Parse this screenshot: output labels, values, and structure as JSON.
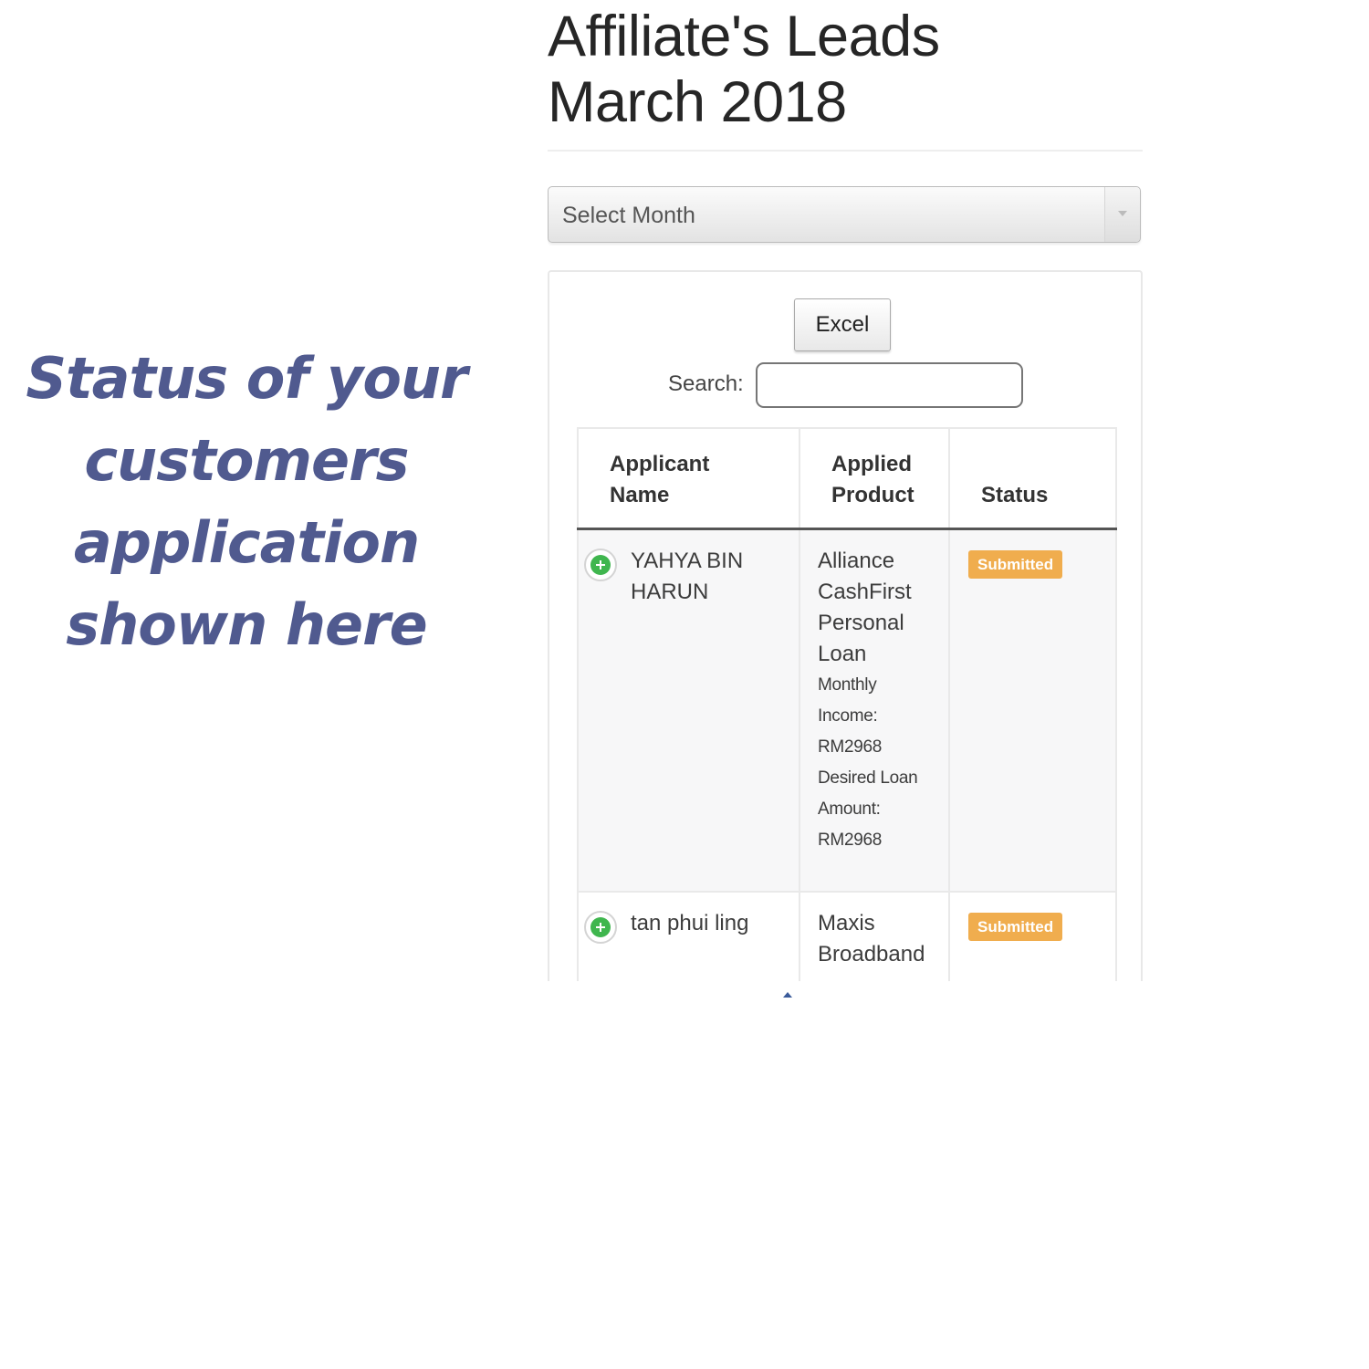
{
  "caption": {
    "lines": [
      "Status of your",
      "customers",
      "application",
      "shown here"
    ]
  },
  "page": {
    "title_lines": [
      "Affiliate's Leads",
      "March 2018"
    ]
  },
  "month_select": {
    "placeholder": "Select Month"
  },
  "toolbar": {
    "excel_label": "Excel",
    "search_label": "Search:",
    "search_value": ""
  },
  "table": {
    "headers": {
      "applicant_name": [
        "Applicant",
        "Name"
      ],
      "applied_product": [
        "Applied",
        "Product"
      ],
      "status": "Status"
    },
    "rows": [
      {
        "name_lines": [
          "YAHYA BIN",
          "HARUN"
        ],
        "product_lines": [
          "Alliance",
          "CashFirst",
          "Personal",
          "Loan"
        ],
        "detail_lines": [
          "Monthly",
          "Income:",
          "RM2968",
          "Desired Loan",
          "Amount:",
          "RM2968"
        ],
        "status": "Submitted"
      },
      {
        "name_lines": [
          "tan phui ling"
        ],
        "product_lines": [
          "Maxis",
          "Broadband"
        ],
        "detail_lines": [],
        "status": "Submitted"
      }
    ]
  },
  "icons": {
    "expand_row": "plus-circle-icon",
    "select_arrow": "chevron-down-icon"
  },
  "colors": {
    "caption_text": "#505a8f",
    "badge_submitted": "#f0ad4e",
    "expand_icon": "#3fb64e"
  }
}
